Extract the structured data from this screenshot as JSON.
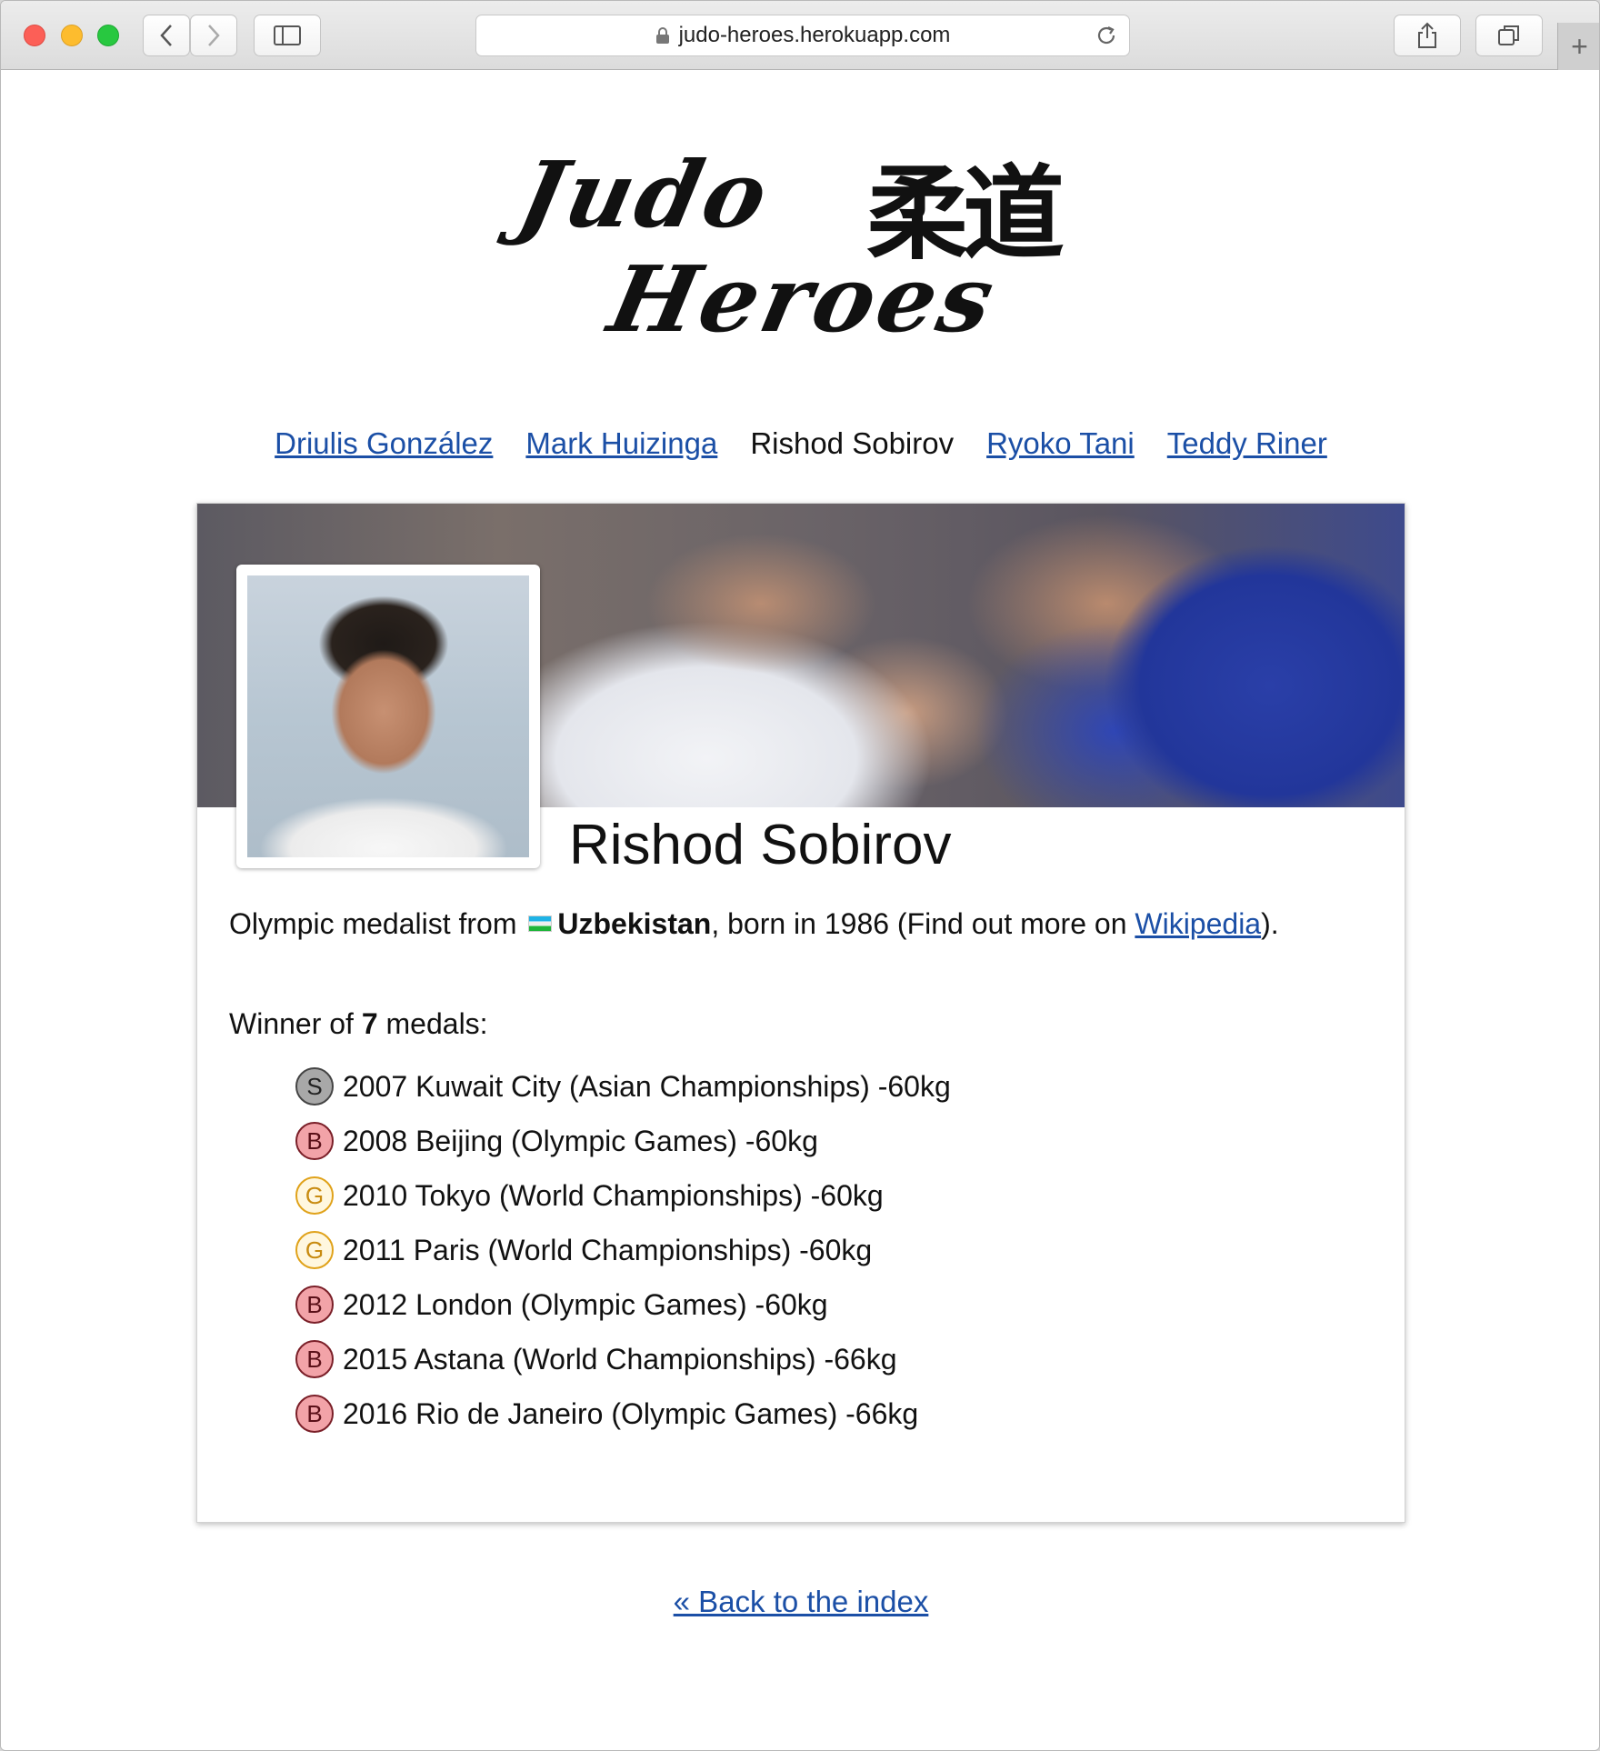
{
  "browser": {
    "url": "judo-heroes.herokuapp.com"
  },
  "logo": {
    "line1": "Judo",
    "kanji": "柔道",
    "line2": "Heroes"
  },
  "nav": {
    "items": [
      {
        "label": "Driulis González"
      },
      {
        "label": "Mark Huizinga"
      },
      {
        "label": "Rishod Sobirov"
      },
      {
        "label": "Ryoko Tani"
      },
      {
        "label": "Teddy Riner"
      }
    ]
  },
  "athlete": {
    "name": "Rishod Sobirov",
    "bio_prefix": "Olympic medalist from ",
    "country": "Uzbekistan",
    "bio_middle": ", born in 1986 (Find out more on ",
    "wiki_label": "Wikipedia",
    "bio_suffix": ").",
    "winner_prefix": "Winner of ",
    "medal_count": "7",
    "winner_suffix": " medals:"
  },
  "medals": [
    {
      "type": "S",
      "text": "2007 Kuwait City (Asian Championships) -60kg"
    },
    {
      "type": "B",
      "text": "2008 Beijing (Olympic Games) -60kg"
    },
    {
      "type": "G",
      "text": "2010 Tokyo (World Championships) -60kg"
    },
    {
      "type": "G",
      "text": "2011 Paris (World Championships) -60kg"
    },
    {
      "type": "B",
      "text": "2012 London (Olympic Games) -60kg"
    },
    {
      "type": "B",
      "text": "2015 Astana (World Championships) -66kg"
    },
    {
      "type": "B",
      "text": "2016 Rio de Janeiro (Olympic Games) -66kg"
    }
  ],
  "footer": {
    "back_label": "« Back to the index"
  },
  "colors": {
    "link": "#1b4fa6",
    "silver": "#a8a8a8",
    "bronze": "#f2a3a8",
    "gold": "#e0a21a"
  }
}
